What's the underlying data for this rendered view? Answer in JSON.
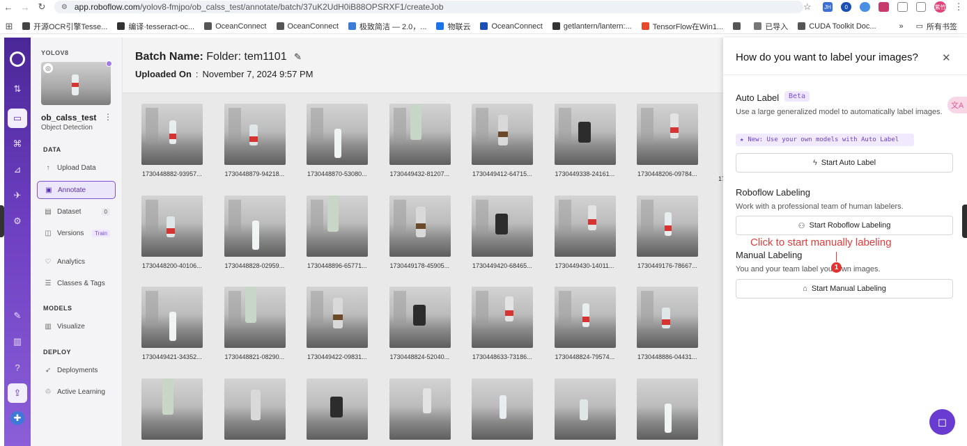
{
  "browser": {
    "url_host": "app.roboflow.com",
    "url_path": "/yolov8-fmjpo/ob_calss_test/annotate/batch/37uK2UdH0iB88OPSRXF1/createJob",
    "ext_badge": "0",
    "ext_label_jh": "JH",
    "ext_avatar": "紫竹"
  },
  "bookmarks": [
    {
      "label": "开源OCR引擎Tesse...",
      "color": "#444444"
    },
    {
      "label": "编译·tesseract-oc...",
      "color": "#333333"
    },
    {
      "label": "OceanConnect",
      "color": "#555555"
    },
    {
      "label": "OceanConnect",
      "color": "#555555"
    },
    {
      "label": "极致简洁 — 2.0，...",
      "color": "#3a7bd5"
    },
    {
      "label": "物联云",
      "color": "#1a73e8"
    },
    {
      "label": "OceanConnect",
      "color": "#1a4fb5"
    },
    {
      "label": "getlantern/lantern:...",
      "color": "#333333"
    },
    {
      "label": "TensorFlow在Win1...",
      "color": "#e8492c"
    },
    {
      "label": "",
      "color": "#555555"
    },
    {
      "label": "已导入",
      "color": "#777777"
    },
    {
      "label": "CUDA Toolkit Doc...",
      "color": "#555555"
    }
  ],
  "bookmarks_all": "所有书签",
  "sidebar": {
    "workspace": "YOLOV8",
    "project": "ob_calss_test",
    "project_type": "Object Detection",
    "sections": {
      "data": "DATA",
      "models": "MODELS",
      "deploy": "DEPLOY"
    },
    "items": [
      {
        "label": "Upload Data",
        "icon": "↑"
      },
      {
        "label": "Annotate",
        "icon": "▣"
      },
      {
        "label": "Dataset",
        "icon": "▤",
        "badge": "0"
      },
      {
        "label": "Versions",
        "icon": "◫",
        "badge": "Train"
      },
      {
        "label": "Analytics",
        "icon": "♡"
      },
      {
        "label": "Classes & Tags",
        "icon": "☰"
      },
      {
        "label": "Visualize",
        "icon": "▥"
      },
      {
        "label": "Deployments",
        "icon": "➶"
      },
      {
        "label": "Active Learning",
        "icon": "♲"
      }
    ]
  },
  "main": {
    "batch_label": "Batch Name:",
    "batch_value": "Folder: tem1101",
    "uploaded_label": "Uploaded On",
    "uploaded_sep": ":",
    "uploaded_value": "November 7, 2024 9:57 PM",
    "images": [
      "1730448882-93957...",
      "1730448879-94218...",
      "1730448870-53080...",
      "1730449432-81207...",
      "1730449412-64715...",
      "1730449338-24161...",
      "1730448206-09784...",
      "1730448200-40106...",
      "1730448828-02959...",
      "1730448896-65771...",
      "1730449178-45905...",
      "1730449420-68465...",
      "1730449430-14011...",
      "1730449176-78667...",
      "1730449421-34352...",
      "1730448821-08290...",
      "1730449422-09831...",
      "1730448824-52040...",
      "1730448633-73186...",
      "1730448824-79574...",
      "1730448886-04431..."
    ],
    "partial_caption": "17"
  },
  "panel": {
    "title": "How do you want to label your images?",
    "auto_title": "Auto Label",
    "auto_beta": "Beta",
    "auto_desc": "Use a large generalized model to automatically label images.",
    "auto_new": "New: Use your own models with Auto Label",
    "auto_btn": "Start Auto Label",
    "rf_title": "Roboflow Labeling",
    "rf_desc": "Work with a professional team of human labelers.",
    "rf_btn": "Start Roboflow Labeling",
    "manual_title": "Manual Labeling",
    "manual_desc": "You and your team label your own images.",
    "manual_btn": "Start Manual Labeling"
  },
  "hint": {
    "text": "Click to start manually labeling",
    "step": "1"
  },
  "translate_label": "文A",
  "colors": {
    "accent": "#6a3bd1",
    "hint": "#e23a3a"
  }
}
